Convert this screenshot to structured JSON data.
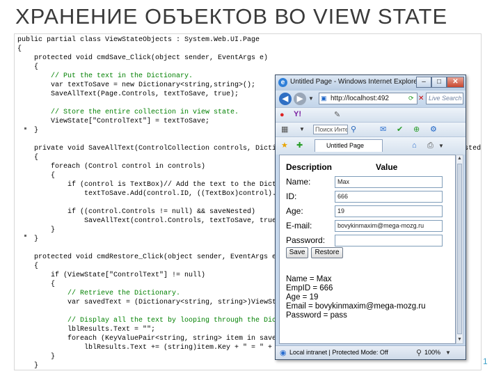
{
  "slide": {
    "title": "ХРАНЕНИЕ ОБЪЕКТОВ ВО VIEW STATE",
    "page_number": "1"
  },
  "code": {
    "lines": [
      "public partial class ViewStateObjects : System.Web.UI.Page",
      "{",
      "    protected void cmdSave_Click(object sender, EventArgs e)",
      "    {",
      "        // Put the text in the Dictionary.",
      "        var textToSave = new Dictionary<string,string>();",
      "        SaveAllText(Page.Controls, textToSave, true);",
      "",
      "        // Store the entire collection in view state.",
      "        ViewState[\"ControlText\"] = textToSave;",
      "    }",
      "",
      "    private void SaveAllText(ControlCollection controls, Dictionary<string, string> textToSave, bool saveNested)",
      "    {",
      "        foreach (Control control in controls)",
      "        {",
      "            if (control is TextBox)// Add the text to the Dictionary.",
      "                textToSave.Add(control.ID, ((TextBox)control).Text);",
      "",
      "            if ((control.Controls != null) && saveNested)",
      "                SaveAllText(control.Controls, textToSave, true);",
      "        }",
      "    }",
      "",
      "    protected void cmdRestore_Click(object sender, EventArgs e)",
      "    {",
      "        if (ViewState[\"ControlText\"] != null)",
      "        {",
      "            // Retrieve the Dictionary.",
      "            var savedText = (Dictionary<string, string>)ViewState[\"ControlText\"];",
      "",
      "            // Display all the text by looping through the Dictionary.",
      "            lblResults.Text = \"\";",
      "            foreach (KeyValuePair<string, string> item in savedText)",
      "                lblResults.Text += (string)item.Key + \" = \" + item.Value + \"<br />\";",
      "        }",
      "    }",
      "}"
    ]
  },
  "browser": {
    "window_title": "Untitled Page - Windows Internet Explorer",
    "address": "http://localhost:492",
    "search_placeholder": "Live Search",
    "toolbar_search": "Поиск Интернет",
    "tab_title": "Untitled Page",
    "status_zone": "Local intranet | Protected Mode: Off",
    "zoom": "100%",
    "icons": [
      "ie-logo-icon",
      "back-icon",
      "forward-icon",
      "refresh-icon",
      "stop-icon",
      "search-icon",
      "favorites-star-icon",
      "home-icon",
      "print-icon"
    ]
  },
  "form": {
    "header_description": "Description",
    "header_value": "Value",
    "fields": [
      {
        "label": "Name:",
        "value": "Max"
      },
      {
        "label": "ID:",
        "value": "666"
      },
      {
        "label": "Age:",
        "value": "19"
      },
      {
        "label": "E-mail:",
        "value": "bovykinmaxim@mega-mozg.ru"
      },
      {
        "label": "Password:",
        "value": ""
      }
    ],
    "save_label": "Save",
    "restore_label": "Restore",
    "results": [
      "Name = Max",
      "EmpID = 666",
      "Age = 19",
      "Email = bovykinmaxim@mega-mozg.ru",
      "Password = pass"
    ]
  },
  "colors": {
    "title": "#3a3a3a",
    "keyword": "#0000ff",
    "comment": "#008000",
    "type": "#2b91af",
    "accent": "#3aa0c8"
  }
}
